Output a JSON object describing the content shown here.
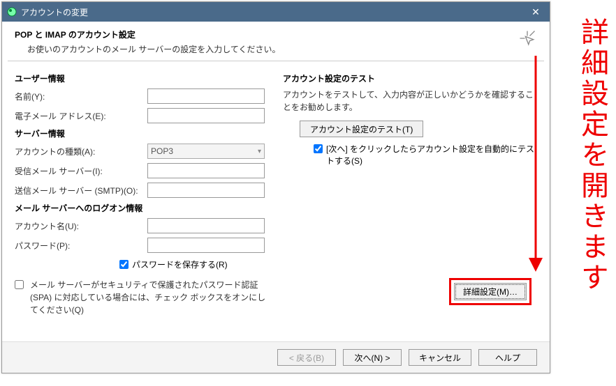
{
  "titlebar": {
    "title": "アカウントの変更",
    "close_label": "✕"
  },
  "header": {
    "title": "POP と IMAP のアカウント設定",
    "subtitle": "お使いのアカウントのメール サーバーの設定を入力してください。"
  },
  "left": {
    "user_info_head": "ユーザー情報",
    "name_label": "名前(Y):",
    "email_label": "電子メール アドレス(E):",
    "server_info_head": "サーバー情報",
    "account_type_label": "アカウントの種類(A):",
    "account_type_value": "POP3",
    "incoming_label": "受信メール サーバー(I):",
    "outgoing_label": "送信メール サーバー (SMTP)(O):",
    "logon_head": "メール サーバーへのログオン情報",
    "account_name_label": "アカウント名(U):",
    "password_label": "パスワード(P):",
    "save_password_label": "パスワードを保存する(R)",
    "spa_label": "メール サーバーがセキュリティで保護されたパスワード認証 (SPA) に対応している場合には、チェック ボックスをオンにしてください(Q)"
  },
  "right": {
    "test_head": "アカウント設定のテスト",
    "test_desc": "アカウントをテストして、入力内容が正しいかどうかを確認することをお勧めします。",
    "test_button": "アカウント設定のテスト(T)",
    "auto_test_label": "[次へ] をクリックしたらアカウント設定を自動的にテストする(S)",
    "details_button": "詳細設定(M)…"
  },
  "footer": {
    "back": "< 戻る(B)",
    "next": "次へ(N) >",
    "cancel": "キャンセル",
    "help": "ヘルプ"
  },
  "annotation": "詳細設定を開きます",
  "values": {
    "name": "",
    "email": "",
    "incoming": "",
    "outgoing": "",
    "account_name": "",
    "password": ""
  }
}
